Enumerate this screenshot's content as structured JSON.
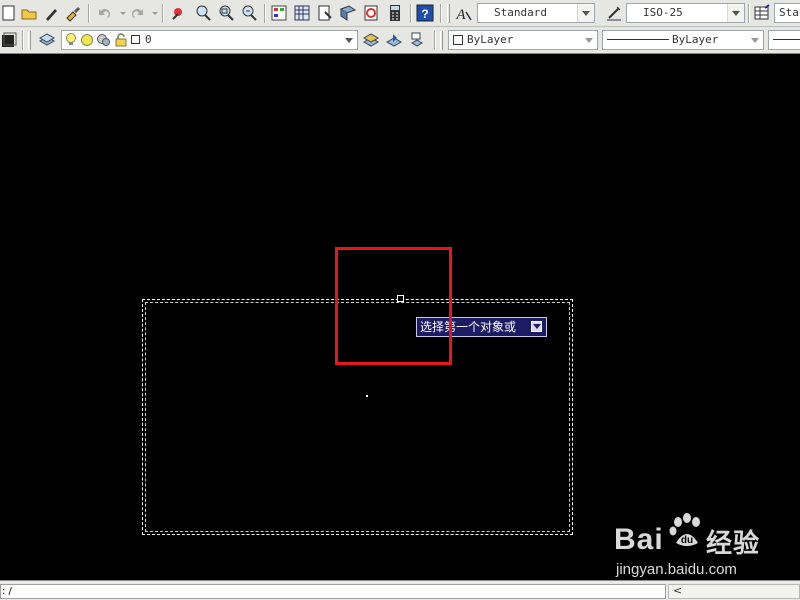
{
  "toolbar_standard": {
    "icons": [
      "new-icon",
      "open-icon",
      "match-properties-icon",
      "brush-icon",
      "undo-icon",
      "redo-icon",
      "pan-icon",
      "zoom-realtime-icon",
      "zoom-window-icon",
      "zoom-previous-icon",
      "properties-icon",
      "design-center-icon",
      "tool-palettes-icon",
      "sheet-set-icon",
      "markup-icon",
      "calculator-icon",
      "help-icon"
    ]
  },
  "toolbar_styles": {
    "text_style": "Standard",
    "dim_style": "ISO-25",
    "table_style_partial": "Stan"
  },
  "toolbar_layers": {
    "layer_name": "0",
    "color": "ByLayer",
    "linetype": "ByLayer"
  },
  "canvas": {
    "tooltip_prompt": "选择第一个对象或",
    "background": "#000000",
    "highlight_color": "#e8161b"
  },
  "watermark": {
    "brand": "Bai",
    "brand_suffix": "经验",
    "url": "jingyan.baidu.com"
  },
  "statusbar": {
    "command_text": ": /",
    "scroll_left": "<"
  }
}
